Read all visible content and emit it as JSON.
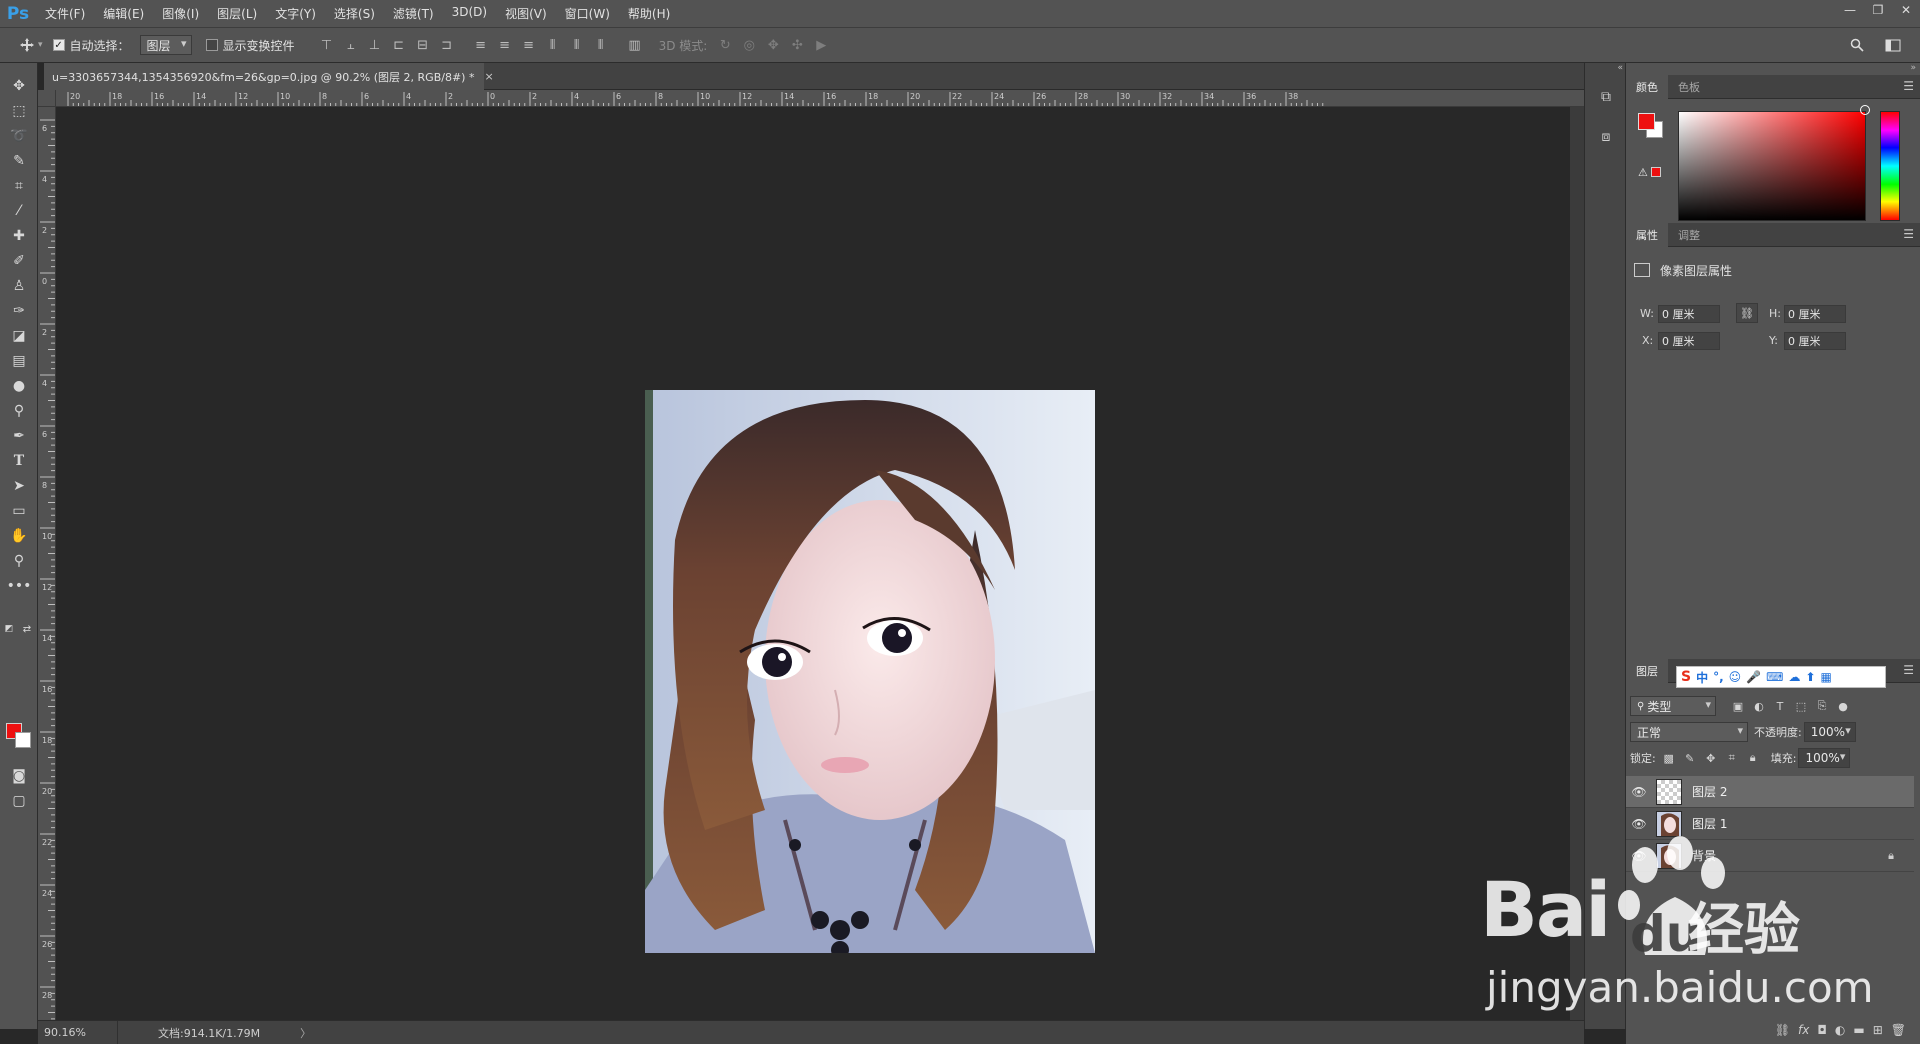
{
  "app": {
    "logo": "Ps"
  },
  "menu": [
    "文件(F)",
    "编辑(E)",
    "图像(I)",
    "图层(L)",
    "文字(Y)",
    "选择(S)",
    "滤镜(T)",
    "3D(D)",
    "视图(V)",
    "窗口(W)",
    "帮助(H)"
  ],
  "window_controls": {
    "minimize": "—",
    "restore": "❐",
    "close": "✕"
  },
  "options": {
    "auto_select_label": "自动选择：",
    "auto_select_checked": true,
    "auto_select_target": "图层",
    "show_transform_label": "显示变换控件",
    "mode_3d_label": "3D 模式:"
  },
  "document": {
    "tab_title": "u=3303657344,1354356920&fm=26&gp=0.jpg @ 90.2% (图层 2, RGB/8#) *",
    "close_glyph": "×"
  },
  "rulers": {
    "top_labels": [
      "20",
      "18",
      "16",
      "14",
      "12",
      "10",
      "8",
      "6",
      "4",
      "2",
      "0",
      "2",
      "4",
      "6",
      "8",
      "10",
      "12",
      "14",
      "16",
      "18",
      "20",
      "22",
      "24",
      "26",
      "28",
      "30",
      "32",
      "34",
      "36",
      "38"
    ],
    "left_labels": [
      "6",
      "4",
      "2",
      "0",
      "2",
      "4",
      "6",
      "8",
      "10",
      "12",
      "14",
      "16",
      "18",
      "20",
      "22",
      "24",
      "26",
      "28"
    ]
  },
  "status": {
    "zoom": "90.16%",
    "doc_size": "文档:914.1K/1.79M",
    "arrow": "〉"
  },
  "colors": {
    "foreground": "#ee1010",
    "background": "#ffffff",
    "accent": "#3aa0e8"
  },
  "color_panel": {
    "tabs": [
      "颜色",
      "色板"
    ]
  },
  "properties_panel": {
    "tabs": [
      "属性",
      "调整"
    ],
    "title": "像素图层属性",
    "w_label": "W:",
    "w_value": "0 厘米",
    "h_label": "H:",
    "h_value": "0 厘米",
    "x_label": "X:",
    "x_value": "0 厘米",
    "y_label": "Y:",
    "y_value": "0 厘米"
  },
  "layers_panel": {
    "tab": "图层",
    "filter_kind": "类型",
    "blend_mode": "正常",
    "opacity_label": "不透明度:",
    "opacity_value": "100%",
    "lock_label": "锁定:",
    "fill_label": "填充:",
    "fill_value": "100%",
    "layers": [
      {
        "name": "图层 2",
        "selected": true,
        "thumb": "transparent",
        "locked": false
      },
      {
        "name": "图层 1",
        "selected": false,
        "thumb": "photo",
        "locked": false
      },
      {
        "name": "背景",
        "selected": false,
        "thumb": "photo",
        "locked": true
      }
    ]
  },
  "ime": {
    "logo": "S",
    "mode": "中"
  },
  "watermark": {
    "brand": "Bai",
    "brand2": "du",
    "product": "经验",
    "url": "jingyan.baidu.com"
  }
}
